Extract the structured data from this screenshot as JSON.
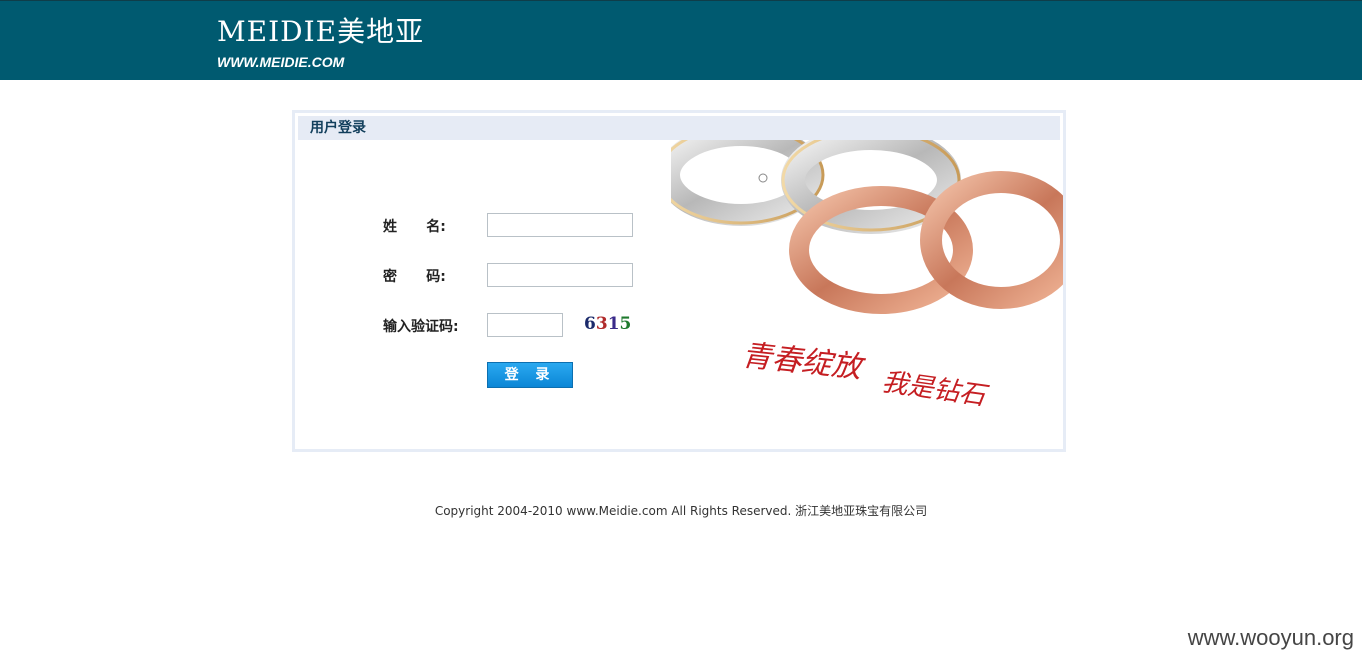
{
  "header": {
    "logo_text": "MEIDIE美地亚",
    "logo_url": "WWW.MEIDIE.COM"
  },
  "panel": {
    "title": "用户登录"
  },
  "form": {
    "username_label": "姓      名:",
    "password_label": "密      码:",
    "captcha_label": "输入验证码:",
    "username_value": "",
    "password_value": "",
    "captcha_value": "",
    "captcha_digits": [
      "6",
      "3",
      "1",
      "5"
    ],
    "login_button": "登 录"
  },
  "banner": {
    "slogan_1": "青春绽放",
    "slogan_2": "我是钻石"
  },
  "footer": {
    "copyright": "Copyright 2004-2010 www.Meidie.com All Rights Reserved. 浙江美地亚珠宝有限公司"
  },
  "watermark": "www.wooyun.org",
  "colors": {
    "header_bg": "#005a70",
    "panel_title_bg": "#e6ebf5",
    "button_bg": "#1a9ae4",
    "captcha_digit_colors": [
      "#1b2a6b",
      "#b12b2b",
      "#3a2a8a",
      "#1f7a2e"
    ],
    "slogan_color": "#c51e22"
  }
}
